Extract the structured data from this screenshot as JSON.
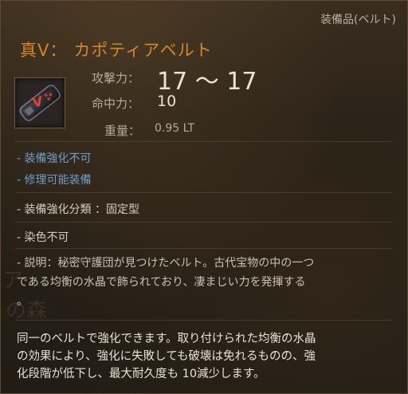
{
  "header": {
    "category": "装備品(ベルト)",
    "title_prefix": "真V：",
    "title_name": "カポティアベルト"
  },
  "item_icon": {
    "name": "belt-icon",
    "accent": "#c0392b"
  },
  "stats": {
    "attack": {
      "label": "攻撃力：",
      "value": "17 ～ 17"
    },
    "accuracy": {
      "label": "命中力：",
      "value": "10"
    },
    "weight": {
      "label": "重量：",
      "value": "0.95 LT"
    }
  },
  "flags": {
    "enhance": "- 装備強化不可",
    "repair": "- 修理可能装備",
    "enhance_type": "- 装備強化分類 ：固定型",
    "dye": "- 染色不可"
  },
  "description": {
    "line1": "- 説明：秘密守護団が見つけたベルト。古代宝物の中の一つ",
    "line2": "である均衡の水晶で飾られており、凄まじい力を発揮する",
    "line3": "。"
  },
  "crystal_note": {
    "line1": "同一のベルトで強化できます。取り付けられた均衡の水晶",
    "line2": "の効果により、強化に失敗しても破壊は免れるものの、強",
    "line3": "化段階が低下し、最大耐久度も 10減少します。"
  },
  "colors": {
    "title": "#d2872f",
    "blue_text": "#6f9ec9",
    "stat_value": "#e9e3d6"
  }
}
